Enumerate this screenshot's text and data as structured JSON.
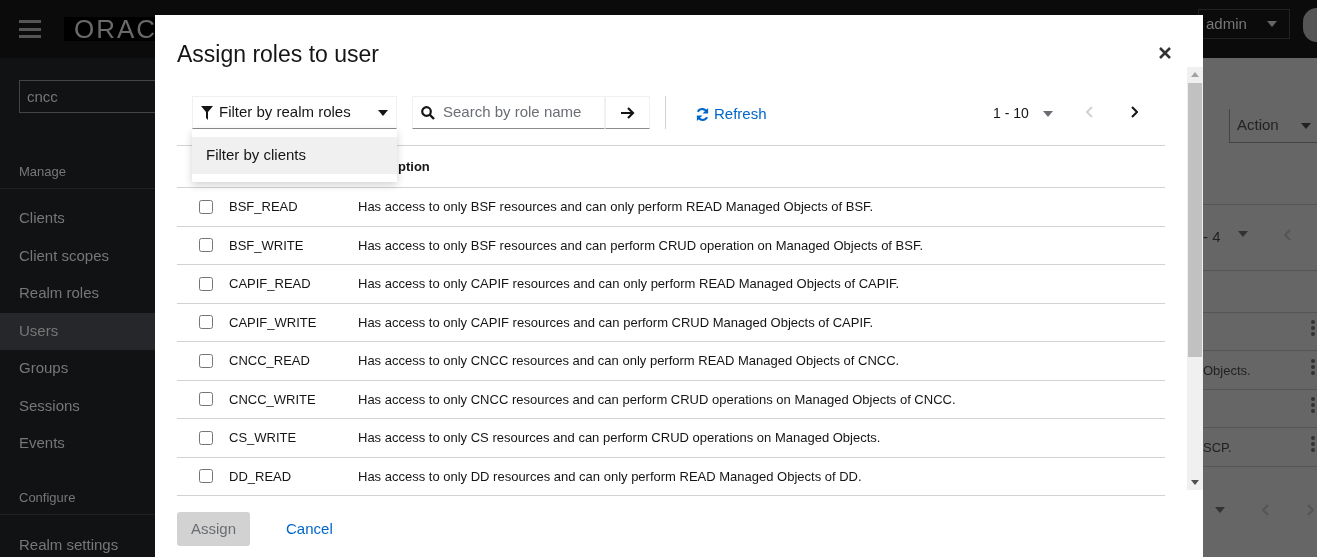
{
  "header": {
    "logo": "ORAC",
    "user": "admin"
  },
  "sidebar": {
    "search": {
      "value": "cncc"
    },
    "sections": [
      {
        "title": "Manage",
        "items": [
          {
            "label": "Clients",
            "selected": false
          },
          {
            "label": "Client scopes",
            "selected": false
          },
          {
            "label": "Realm roles",
            "selected": false
          },
          {
            "label": "Users",
            "selected": true
          },
          {
            "label": "Groups",
            "selected": false
          },
          {
            "label": "Sessions",
            "selected": false
          },
          {
            "label": "Events",
            "selected": false
          }
        ]
      },
      {
        "title": "Configure",
        "items": [
          {
            "label": "Realm settings",
            "selected": false
          }
        ]
      }
    ]
  },
  "background": {
    "action": "Action",
    "pagination": "- 4",
    "rows": [
      {
        "kind": "blank"
      },
      {
        "kind": "text",
        "text": "Objects."
      },
      {
        "kind": "blank"
      },
      {
        "kind": "text",
        "text": "SCP."
      }
    ]
  },
  "dialog": {
    "title": "Assign roles to user",
    "filter": {
      "label": "Filter by realm roles",
      "expanded": true,
      "options": [
        "Filter by clients"
      ]
    },
    "search": {
      "placeholder": "Search by role name"
    },
    "refresh": "Refresh",
    "pagination": "1 - 10",
    "table": {
      "columns": [
        "",
        "ption"
      ],
      "rows": [
        {
          "name": "BSF_READ",
          "description": "Has access to only BSF resources and can only perform READ Managed Objects of BSF.",
          "checked": false
        },
        {
          "name": "BSF_WRITE",
          "description": "Has access to only BSF resources and can perform CRUD operation on Managed Objects of BSF.",
          "checked": false
        },
        {
          "name": "CAPIF_READ",
          "description": "Has access to only CAPIF resources and can only perform READ Managed Objects of CAPIF.",
          "checked": false
        },
        {
          "name": "CAPIF_WRITE",
          "description": "Has access to only CAPIF resources and can perform CRUD Managed Objects of CAPIF.",
          "checked": false
        },
        {
          "name": "CNCC_READ",
          "description": "Has access to only CNCC resources and can only perform READ Managed Objects of CNCC.",
          "checked": false
        },
        {
          "name": "CNCC_WRITE",
          "description": "Has access to only CNCC resources and can perform CRUD operations on Managed Objects of CNCC.",
          "checked": false
        },
        {
          "name": "CS_WRITE",
          "description": "Has access to only CS resources and can perform CRUD operations on Managed Objects.",
          "checked": false
        },
        {
          "name": "DD_READ",
          "description": "Has access to only DD resources and can only perform READ Managed Objects of DD.",
          "checked": false
        }
      ]
    },
    "buttons": [
      {
        "label": "Assign",
        "kind": "primary",
        "disabled": true
      },
      {
        "label": "Cancel",
        "kind": "link",
        "disabled": false
      }
    ]
  }
}
